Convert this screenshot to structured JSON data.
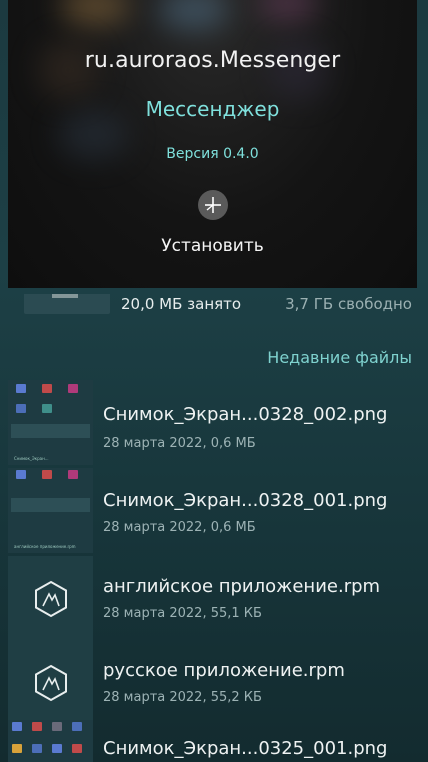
{
  "dialog": {
    "package_name": "ru.auroraos.Messenger",
    "app_name": "Мессенджер",
    "version": "Версия 0.4.0",
    "install_icon": "install-plus-icon",
    "install_label": "Установить"
  },
  "storage": {
    "used": "20,0 МБ занято",
    "free": "3,7 ГБ свободно"
  },
  "recent": {
    "header": "Недавние файлы",
    "files": [
      {
        "name": "Снимок_Экран...0328_002.png",
        "meta": "28 марта 2022, 0,6 МБ",
        "type": "screenshot"
      },
      {
        "name": "Снимок_Экран...0328_001.png",
        "meta": "28 марта 2022, 0,6 МБ",
        "type": "screenshot"
      },
      {
        "name": "английское приложение.rpm",
        "meta": "28 марта 2022, 55,1 КБ",
        "type": "package"
      },
      {
        "name": "русское приложение.rpm",
        "meta": "28 марта 2022, 55,2 КБ",
        "type": "package"
      },
      {
        "name": "Снимок_Экран...0325_001.png",
        "meta": "",
        "type": "screenshot"
      }
    ]
  },
  "colors": {
    "accent": "#7fe0dc",
    "dialog_bg": "#141414",
    "page_bg": "#1d4046"
  }
}
